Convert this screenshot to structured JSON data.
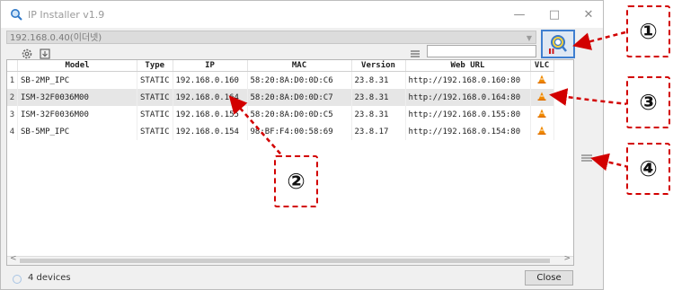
{
  "window": {
    "title": "IP Installer v1.9",
    "minimize": "—",
    "maximize": "□",
    "close": "✕"
  },
  "toolbar": {
    "interface_value": "192.168.0.40(이더넷)",
    "filter_value": ""
  },
  "table": {
    "columns": [
      "Model",
      "Type",
      "IP",
      "MAC",
      "Version",
      "Web URL",
      "VLC"
    ],
    "rows": [
      {
        "num": "1",
        "model": "SB-2MP_IPC",
        "type": "STATIC",
        "ip": "192.168.0.160",
        "mac": "58:20:8A:D0:0D:C6",
        "version": "23.8.31",
        "url": "http://192.168.0.160:80"
      },
      {
        "num": "2",
        "model": "ISM-32F0036M00",
        "type": "STATIC",
        "ip": "192.168.0.164",
        "mac": "58:20:8A:D0:0D:C7",
        "version": "23.8.31",
        "url": "http://192.168.0.164:80"
      },
      {
        "num": "3",
        "model": "ISM-32F0036M00",
        "type": "STATIC",
        "ip": "192.168.0.155",
        "mac": "58:20:8A:D0:0D:C5",
        "version": "23.8.31",
        "url": "http://192.168.0.155:80"
      },
      {
        "num": "4",
        "model": "SB-5MP_IPC",
        "type": "STATIC",
        "ip": "192.168.0.154",
        "mac": "98:BF:F4:00:58:69",
        "version": "23.8.17",
        "url": "http://192.168.0.154:80"
      }
    ]
  },
  "status": {
    "device_count": "4 devices",
    "close_label": "Close"
  },
  "callouts": [
    "①",
    "②",
    "③",
    "④"
  ],
  "colors": {
    "callout_red": "#d20000",
    "selection": "#e6e6e6",
    "search_border": "#3f7fd0",
    "vlc_orange": "#f08a00"
  },
  "icons": {
    "app": "magnifier-icon",
    "search": "search-devices-icon",
    "settings": "gear-icon",
    "export": "export-icon",
    "filter": "list-filter-icon",
    "vlc": "vlc-cone-icon",
    "side": "menu-lines-icon"
  }
}
